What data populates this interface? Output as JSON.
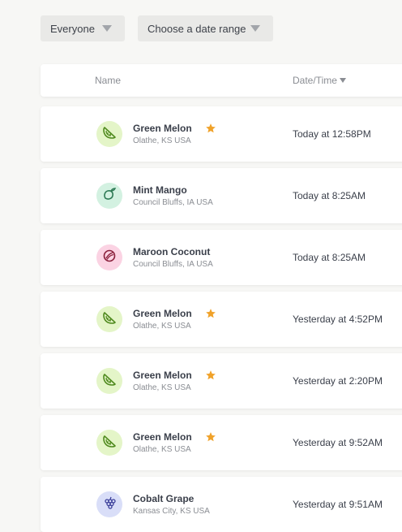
{
  "filters": {
    "people": "Everyone",
    "date_range": "Choose a date range"
  },
  "table": {
    "headers": {
      "name": "Name",
      "datetime": "Date/Time"
    },
    "rows": [
      {
        "name": "Green Melon",
        "location": "Olathe, KS USA",
        "time": "Today at 12:58PM",
        "starred": true,
        "icon": "melon-icon",
        "avatar_bg": "#e4f5c8",
        "icon_color": "#4f8a1e"
      },
      {
        "name": "Mint Mango",
        "location": "Council Bluffs, IA USA",
        "time": "Today at 8:25AM",
        "starred": false,
        "icon": "mango-icon",
        "avatar_bg": "#d3f1e1",
        "icon_color": "#2e7a55"
      },
      {
        "name": "Maroon Coconut",
        "location": "Council Bluffs, IA USA",
        "time": "Today at 8:25AM",
        "starred": false,
        "icon": "coconut-icon",
        "avatar_bg": "#fbd3e3",
        "icon_color": "#8a1f3b"
      },
      {
        "name": "Green Melon",
        "location": "Olathe, KS USA",
        "time": "Yesterday at 4:52PM",
        "starred": true,
        "icon": "melon-icon",
        "avatar_bg": "#e4f5c8",
        "icon_color": "#4f8a1e"
      },
      {
        "name": "Green Melon",
        "location": "Olathe, KS USA",
        "time": "Yesterday at 2:20PM",
        "starred": true,
        "icon": "melon-icon",
        "avatar_bg": "#e4f5c8",
        "icon_color": "#4f8a1e"
      },
      {
        "name": "Green Melon",
        "location": "Olathe, KS USA",
        "time": "Yesterday at 9:52AM",
        "starred": true,
        "icon": "melon-icon",
        "avatar_bg": "#e4f5c8",
        "icon_color": "#4f8a1e"
      },
      {
        "name": "Cobalt Grape",
        "location": "Kansas City, KS USA",
        "time": "Yesterday at 9:51AM",
        "starred": false,
        "icon": "grape-icon",
        "avatar_bg": "#d9def8",
        "icon_color": "#3b3f9a"
      }
    ]
  },
  "colors": {
    "star": "#f0a22a"
  }
}
